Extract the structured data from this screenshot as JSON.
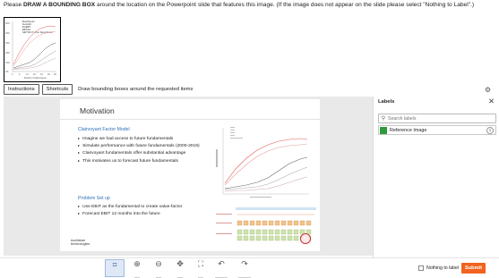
{
  "task": {
    "prefix": "Please ",
    "emphasis": "DRAW A BOUNDING BOX",
    "suffix": " around the location on the Powerpoint slide that features this image. (If the image does not appear on the slide please select \"Nothing to Label\".)"
  },
  "reference_image": {
    "legend": [
      "BestofSector",
      "SectorEV",
      "EV/EBIT",
      "EBIT/EV",
      "S&P 500 (Y) Over Same Period"
    ],
    "xlabel": "Months of Clairvoyance",
    "ylabel": "",
    "x_ticks": [
      "0",
      "6",
      "12",
      "18",
      "24",
      "30",
      "36"
    ],
    "y_ticks": [
      "50%",
      "40%",
      "30%",
      "20%",
      "10%",
      "0%"
    ],
    "series_colors": [
      "#e05a5a",
      "#e89b9b",
      "#555555",
      "#999999",
      "#c9a8a8"
    ]
  },
  "toolbar": {
    "instructions_label": "Instructions",
    "shortcuts_label": "Shortcuts",
    "prompt": "Draw bounding boxes around the requested items",
    "settings_icon": "gear-icon"
  },
  "slide": {
    "title": "Motivation",
    "section1": "Clairvoyant Factor Model",
    "bullets1": [
      "Imagine we had access to future fundamentals",
      "Simulate performance with future fundamentals (2000-2019)",
      "Clairvoyant fundamentals offer substantial advantage",
      "This motivates us to forecast future fundamentals"
    ],
    "section2": "Problem Set up",
    "bullets2": [
      "Use EBIT as the fundamental to create value-factor",
      "Forecast EBIT 12 months into the future"
    ],
    "logo_line1": "euclidean",
    "logo_line2": "technologies"
  },
  "labels_panel": {
    "title": "Labels",
    "close_icon": "close-icon",
    "search_placeholder": "Search labels",
    "items": [
      {
        "label": "Reference Image",
        "badge": "1",
        "color": "#2f9a3b"
      }
    ]
  },
  "bottom_tools": [
    {
      "name": "bounding-box-tool",
      "icon": "⌗",
      "key": "B"
    },
    {
      "name": "zoom-in-tool",
      "icon": "⊕",
      "key": "+"
    },
    {
      "name": "zoom-out-tool",
      "icon": "⊖",
      "key": "-"
    },
    {
      "name": "pan-tool",
      "icon": "✥",
      "key": "H"
    },
    {
      "name": "fit-tool",
      "icon": "⛶",
      "key": "F"
    },
    {
      "name": "undo-tool",
      "icon": "↶",
      "key": "Ctrl+Z"
    },
    {
      "name": "redo-tool",
      "icon": "↷",
      "key": "Ctrl+Y"
    }
  ],
  "footer": {
    "nothing_to_label": "Nothing to label",
    "submit_label": "Submit"
  }
}
